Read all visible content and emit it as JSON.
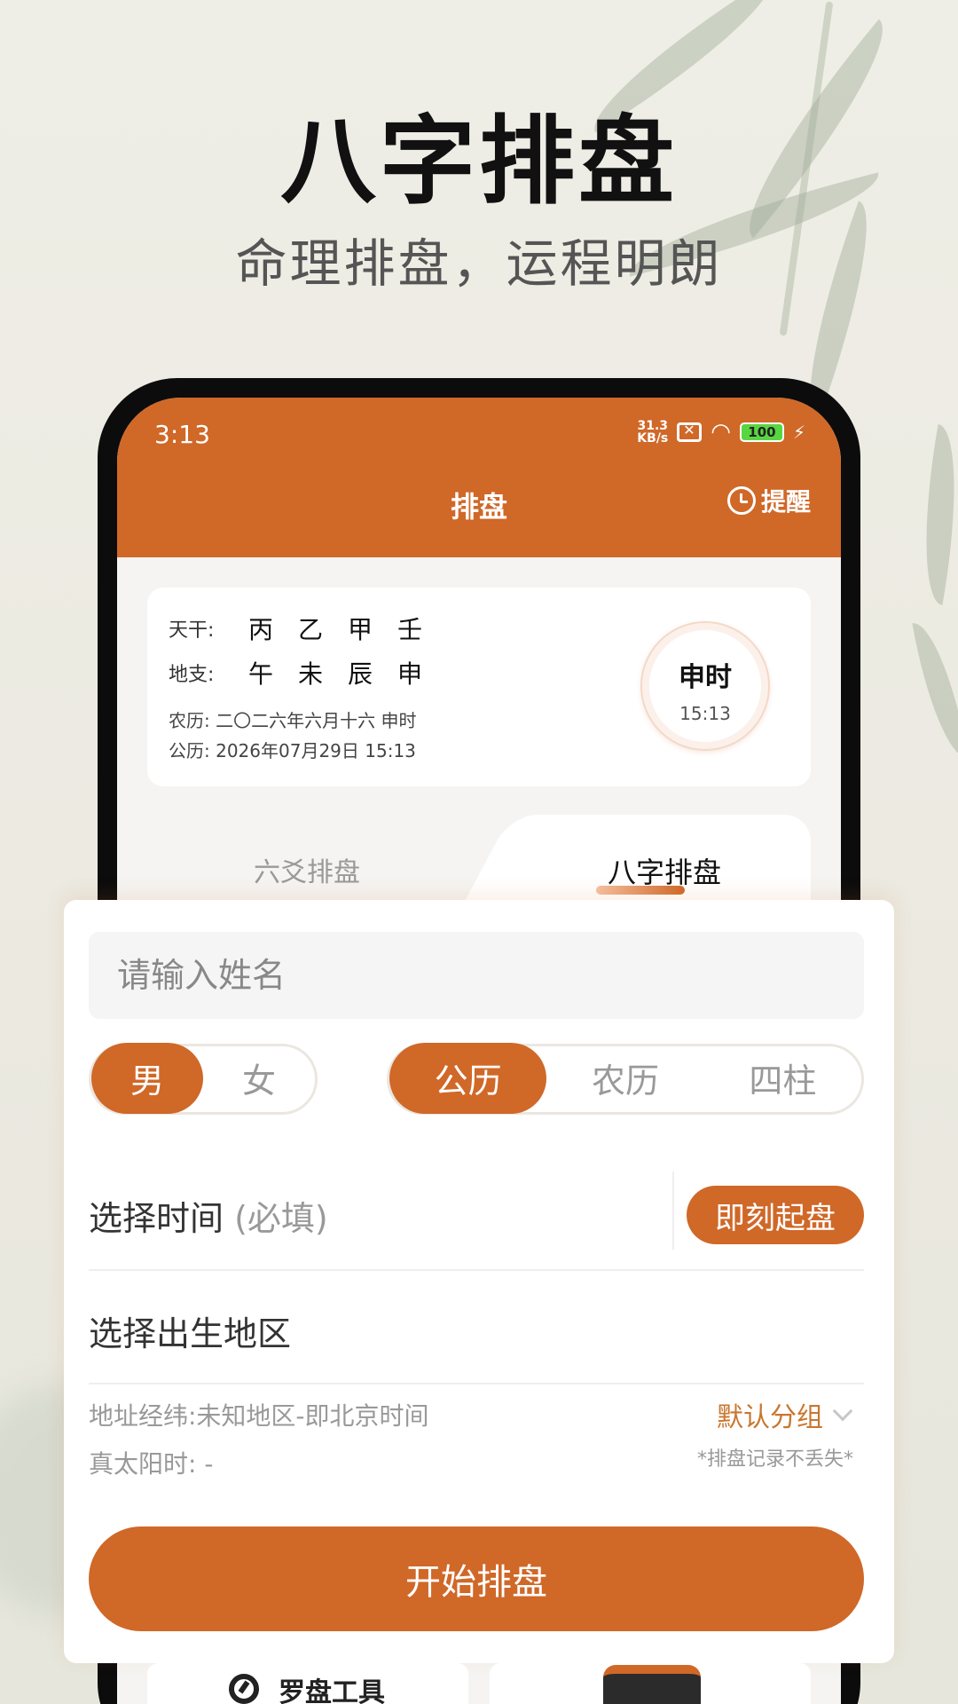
{
  "hero": {
    "title": "八字排盘",
    "subtitle": "命理排盘，运程明朗"
  },
  "status_bar": {
    "time": "3:13",
    "speed_top": "31.3",
    "speed_unit": "KB/s",
    "battery": "100"
  },
  "nav": {
    "title": "排盘",
    "remind_label": "提醒"
  },
  "info_card": {
    "tiangan_label": "天干:",
    "tiangan": [
      "丙",
      "乙",
      "甲",
      "壬"
    ],
    "dizhi_label": "地支:",
    "dizhi": [
      "午",
      "未",
      "辰",
      "申"
    ],
    "lunar_line": "农历: 二〇二六年六月十六 申时",
    "solar_line": "公历: 2026年07月29日 15:13",
    "shichen": "申时",
    "clock_time": "15:13"
  },
  "tabs": {
    "left": "六爻排盘",
    "right": "八字排盘",
    "active": "right"
  },
  "form": {
    "name_placeholder": "请输入姓名",
    "gender": [
      "男",
      "女"
    ],
    "gender_selected": "男",
    "calendar_types": [
      "公历",
      "农历",
      "四柱"
    ],
    "calendar_selected": "公历",
    "time_label": "选择时间",
    "time_required": "(必填)",
    "now_button": "即刻起盘",
    "region_label": "选择出生地区",
    "address_line": "地址经纬:未知地区-即北京时间",
    "solar_time_line": "真太阳时: -",
    "group_label": "默认分组",
    "group_note": "*排盘记录不丢失*",
    "start_button": "开始排盘"
  },
  "bottom": {
    "compass_label": "罗盘工具"
  },
  "colors": {
    "accent": "#d06828",
    "group_text": "#c9772f"
  }
}
